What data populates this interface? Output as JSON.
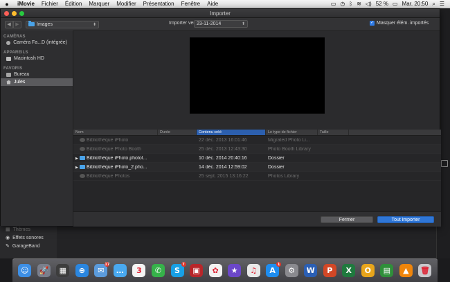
{
  "menubar": {
    "app_name": "iMovie",
    "menus": [
      "Fichier",
      "Édition",
      "Marquer",
      "Modifier",
      "Présentation",
      "Fenêtre",
      "Aide"
    ],
    "battery": "52 %",
    "clock": "Mar. 20:50"
  },
  "dialog": {
    "title": "Importer",
    "location": "Images",
    "import_to_label": "Importer vers :",
    "event_value": "23-11-2014",
    "hide_imported_label": "Masquer élém. importés",
    "hide_imported_checked": true
  },
  "sidebar": {
    "sections": [
      {
        "title": "CAMÉRAS",
        "items": [
          {
            "label": "Caméra Fa...D (intégrée)",
            "icon": "camera-icon"
          }
        ]
      },
      {
        "title": "APPAREILS",
        "items": [
          {
            "label": "Macintosh HD",
            "icon": "disk-icon"
          }
        ]
      },
      {
        "title": "FAVORIS",
        "items": [
          {
            "label": "Bureau",
            "icon": "desktop-icon"
          },
          {
            "label": "Jules",
            "icon": "home-icon",
            "selected": true
          }
        ]
      }
    ]
  },
  "file_list": {
    "columns": [
      "Nom",
      "Durée",
      "Contenu créé",
      "Le type de fichier",
      "Taille"
    ],
    "sorted_column": "Contenu créé",
    "rows": [
      {
        "name": "Bibliothèque iPhoto",
        "duration": "",
        "created": "22 déc. 2013 16:01:46",
        "type": "Migrated Photo Li...",
        "size": "",
        "style": "dim",
        "kind": "lib",
        "expandable": false
      },
      {
        "name": "Bibliothèque Photo Booth",
        "duration": "",
        "created": "25 déc. 2013 12:43:30",
        "type": "Photo Booth Library",
        "size": "",
        "style": "dim",
        "kind": "lib",
        "expandable": false
      },
      {
        "name": "Bibliothèque iPhoto.photol...",
        "duration": "",
        "created": "10 déc. 2014 20:40:16",
        "type": "Dossier",
        "size": "",
        "style": "bright",
        "kind": "dir",
        "expandable": true
      },
      {
        "name": "Bibliothèque iPhoto_2.pho...",
        "duration": "",
        "created": "14 déc. 2014 12:59:02",
        "type": "Dossier",
        "size": "",
        "style": "bright",
        "kind": "dir",
        "expandable": true
      },
      {
        "name": "Bibliothèque Photos",
        "duration": "",
        "created": "25 sept. 2015 13:16:22",
        "type": "Photos Library",
        "size": "",
        "style": "dim",
        "kind": "lib",
        "expandable": false
      }
    ]
  },
  "buttons": {
    "close": "Fermer",
    "import_all": "Tout importer"
  },
  "background_library": {
    "items": [
      {
        "label": "Thèmes",
        "faded": true
      },
      {
        "label": "Effets sonores",
        "faded": false
      },
      {
        "label": "GarageBand",
        "faded": false
      }
    ]
  },
  "dock": [
    {
      "name": "finder-icon",
      "glyph": "☺",
      "color": "#3d8fe6",
      "badge": ""
    },
    {
      "name": "launchpad-icon",
      "glyph": "🚀",
      "color": "#7a7f8c",
      "badge": ""
    },
    {
      "name": "mission-control-icon",
      "glyph": "▦",
      "color": "#3d3d3d",
      "badge": ""
    },
    {
      "name": "safari-icon",
      "glyph": "⊕",
      "color": "#2a86e0",
      "badge": ""
    },
    {
      "name": "mail-icon",
      "glyph": "✉",
      "color": "#5b9bdc",
      "badge": "17"
    },
    {
      "name": "messages-icon",
      "glyph": "…",
      "color": "#49a9f0",
      "badge": ""
    },
    {
      "name": "calendar-icon",
      "glyph": "3",
      "color": "#f4f4f4",
      "badge": ""
    },
    {
      "name": "facetime-icon",
      "glyph": "✆",
      "color": "#36b24a",
      "badge": ""
    },
    {
      "name": "skype-icon",
      "glyph": "S",
      "color": "#18a0e6",
      "badge": "7"
    },
    {
      "name": "photo-booth-icon",
      "glyph": "▣",
      "color": "#b8262a",
      "badge": ""
    },
    {
      "name": "photos-icon",
      "glyph": "✿",
      "color": "#f2f2f2",
      "badge": ""
    },
    {
      "name": "imovie-icon",
      "glyph": "★",
      "color": "#6b47c9",
      "badge": ""
    },
    {
      "name": "itunes-icon",
      "glyph": "♫",
      "color": "#e9e9e9",
      "badge": ""
    },
    {
      "name": "app-store-icon",
      "glyph": "A",
      "color": "#1e8df0",
      "badge": "1"
    },
    {
      "name": "system-preferences-icon",
      "glyph": "⚙",
      "color": "#8a8a8f",
      "badge": ""
    },
    {
      "name": "word-icon",
      "glyph": "W",
      "color": "#2b5fb4",
      "badge": ""
    },
    {
      "name": "powerpoint-icon",
      "glyph": "P",
      "color": "#d24726",
      "badge": ""
    },
    {
      "name": "excel-icon",
      "glyph": "X",
      "color": "#1f7a3e",
      "badge": ""
    },
    {
      "name": "office-icon",
      "glyph": "O",
      "color": "#e8a51b",
      "badge": ""
    },
    {
      "name": "activity-monitor-icon",
      "glyph": "▤",
      "color": "#2f8f3a",
      "badge": ""
    },
    {
      "name": "vlc-icon",
      "glyph": "▲",
      "color": "#f0850b",
      "badge": ""
    },
    {
      "name": "trash-icon",
      "glyph": "🗑",
      "color": "#c8c8cc",
      "badge": ""
    }
  ]
}
